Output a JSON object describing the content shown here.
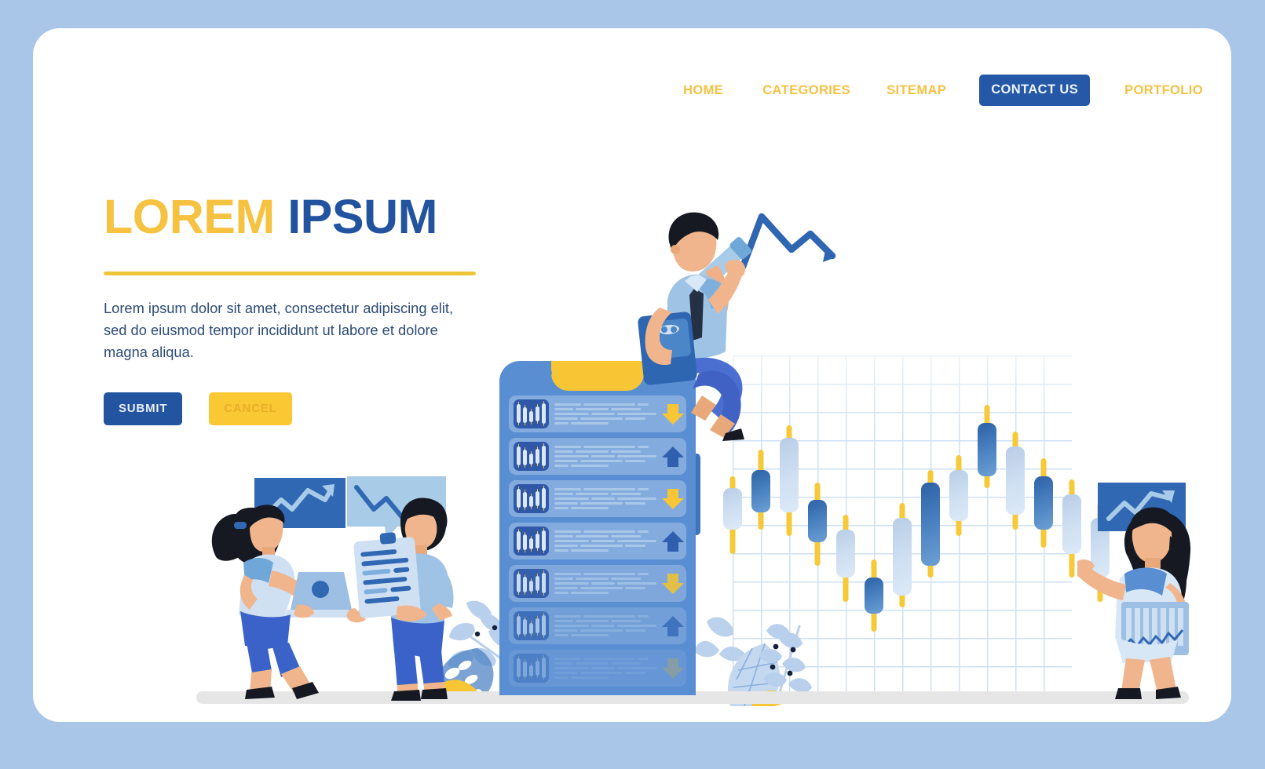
{
  "theme": {
    "page_background": "#a9c6e8",
    "card_background": "#ffffff",
    "brand_yellow": "#f5c242",
    "brand_blue": "#22539f",
    "accent_blue": "#5a8ed2",
    "candle_up": "#cfe0f2",
    "candle_down": "#3f74bd",
    "wick_yellow": "#f6c938",
    "ground_gray": "#e6e6e6"
  },
  "nav": {
    "items": [
      {
        "label": "HOME",
        "style": "link"
      },
      {
        "label": "CATEGORIES",
        "style": "link"
      },
      {
        "label": "SITEMAP",
        "style": "link"
      },
      {
        "label": "CONTACT US",
        "style": "button"
      },
      {
        "label": "PORTFOLIO",
        "style": "link"
      }
    ]
  },
  "hero": {
    "headline_word_1": "LOREM",
    "headline_word_2": "IPSUM",
    "body": "Lorem ipsum dolor sit amet, consectetur adipiscing elit, sed do eiusmod tempor incididunt ut labore et dolore magna aliqua.",
    "submit_label": "SUBMIT",
    "cancel_label": "CANCEL"
  },
  "phone": {
    "rows": [
      {
        "trend": "down"
      },
      {
        "trend": "up"
      },
      {
        "trend": "down"
      },
      {
        "trend": "up"
      },
      {
        "trend": "down"
      },
      {
        "trend": "up"
      },
      {
        "trend": "down"
      }
    ]
  },
  "chart_data": {
    "type": "candlestick",
    "title": "",
    "xlabel": "",
    "ylabel": "",
    "grid": true,
    "grid_spacing_px": 36,
    "legend": "none",
    "colors": {
      "up": "#cfe0f2",
      "down": "#3f74bd",
      "wick": "#f6c938"
    },
    "candles": [
      {
        "i": 1,
        "direction": "up",
        "open": 52,
        "close": 66,
        "high": 70,
        "low": 44
      },
      {
        "i": 2,
        "direction": "down",
        "open": 72,
        "close": 58,
        "high": 79,
        "low": 52
      },
      {
        "i": 3,
        "direction": "up",
        "open": 58,
        "close": 83,
        "high": 87,
        "low": 50
      },
      {
        "i": 4,
        "direction": "down",
        "open": 62,
        "close": 48,
        "high": 68,
        "low": 40
      },
      {
        "i": 5,
        "direction": "up",
        "open": 36,
        "close": 52,
        "high": 57,
        "low": 28
      },
      {
        "i": 6,
        "direction": "down",
        "open": 36,
        "close": 24,
        "high": 42,
        "low": 18
      },
      {
        "i": 7,
        "direction": "up",
        "open": 30,
        "close": 56,
        "high": 61,
        "low": 26
      },
      {
        "i": 8,
        "direction": "down",
        "open": 68,
        "close": 40,
        "high": 72,
        "low": 36
      },
      {
        "i": 9,
        "direction": "up",
        "open": 55,
        "close": 72,
        "high": 77,
        "low": 50
      },
      {
        "i": 10,
        "direction": "down",
        "open": 88,
        "close": 70,
        "high": 94,
        "low": 66
      },
      {
        "i": 11,
        "direction": "up",
        "open": 57,
        "close": 80,
        "high": 85,
        "low": 52
      },
      {
        "i": 12,
        "direction": "down",
        "open": 70,
        "close": 52,
        "high": 76,
        "low": 46
      },
      {
        "i": 13,
        "direction": "up",
        "open": 44,
        "close": 64,
        "high": 69,
        "low": 36
      },
      {
        "i": 14,
        "direction": "up",
        "open": 36,
        "close": 56,
        "high": 61,
        "low": 28
      }
    ]
  },
  "illustrations": {
    "man_on_phone": {
      "name": "businessman-drawing-trend-line",
      "holds": "marker",
      "carries": "tablet",
      "drawn_line": "zigzag-declining-arrow"
    },
    "woman_with_laptop": {
      "name": "woman-with-laptop",
      "bubble": "rising-chart"
    },
    "man_with_clipboard": {
      "name": "man-with-clipboard",
      "bubble": "falling-chart"
    },
    "woman_right": {
      "name": "woman-pointing-at-candlestick",
      "bubble": "rising-chart",
      "carries": "bar-chart-board"
    }
  }
}
